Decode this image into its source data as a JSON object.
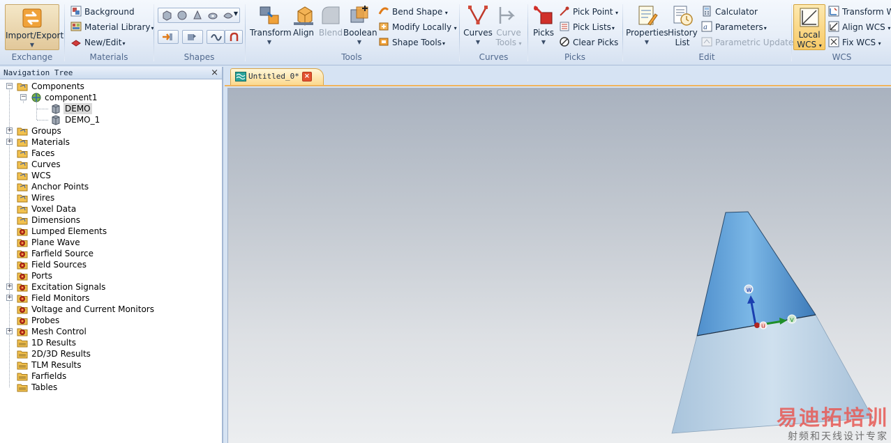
{
  "ribbon": {
    "exchange": {
      "title": "Exchange",
      "import_export": "Import/Export"
    },
    "materials": {
      "title": "Materials",
      "background": "Background",
      "material_library": "Material Library",
      "new_edit": "New/Edit"
    },
    "shapes": {
      "title": "Shapes"
    },
    "tools": {
      "title": "Tools",
      "transform": "Transform",
      "align": "Align",
      "blend": "Blend",
      "boolean": "Boolean",
      "bend_shape": "Bend Shape",
      "modify_locally": "Modify Locally",
      "shape_tools": "Shape Tools"
    },
    "curves": {
      "title": "Curves",
      "curves": "Curves",
      "curve_tools_line1": "Curve",
      "curve_tools_line2": "Tools"
    },
    "picks": {
      "title": "Picks",
      "picks": "Picks",
      "pick_point": "Pick Point",
      "pick_lists": "Pick Lists",
      "clear_picks": "Clear Picks"
    },
    "edit": {
      "title": "Edit",
      "properties": "Properties",
      "history_line1": "History",
      "history_line2": "List",
      "calculator": "Calculator",
      "parameters": "Parameters",
      "parametric_update": "Parametric Update"
    },
    "wcs": {
      "title": "WCS",
      "local_line1": "Local",
      "local_line2": "WCS",
      "transform_wcs": "Transform WCS",
      "align_wcs": "Align WCS",
      "fix_wcs": "Fix WCS"
    }
  },
  "nav": {
    "title": "Navigation Tree",
    "close": "×",
    "items": [
      {
        "label": "Components"
      },
      {
        "label": "component1"
      },
      {
        "label": "DEMO"
      },
      {
        "label": "DEMO_1"
      },
      {
        "label": "Groups"
      },
      {
        "label": "Materials"
      },
      {
        "label": "Faces"
      },
      {
        "label": "Curves"
      },
      {
        "label": "WCS"
      },
      {
        "label": "Anchor Points"
      },
      {
        "label": "Wires"
      },
      {
        "label": "Voxel Data"
      },
      {
        "label": "Dimensions"
      },
      {
        "label": "Lumped Elements"
      },
      {
        "label": "Plane Wave"
      },
      {
        "label": "Farfield Source"
      },
      {
        "label": "Field Sources"
      },
      {
        "label": "Ports"
      },
      {
        "label": "Excitation Signals"
      },
      {
        "label": "Field Monitors"
      },
      {
        "label": "Voltage and Current Monitors"
      },
      {
        "label": "Probes"
      },
      {
        "label": "Mesh Control"
      },
      {
        "label": "1D Results"
      },
      {
        "label": "2D/3D Results"
      },
      {
        "label": "TLM Results"
      },
      {
        "label": "Farfields"
      },
      {
        "label": "Tables"
      }
    ]
  },
  "document": {
    "tab_label": "Untitled_0*",
    "tab_close": "×"
  },
  "viewport": {
    "wcs_u": "u",
    "wcs_v": "v",
    "wcs_w": "w"
  },
  "watermark": {
    "main": "易迪拓培训",
    "sub": "射频和天线设计专家"
  },
  "colors": {
    "accent": "#f0b35a",
    "selection": "#fde9b0",
    "cone_top": "#5c9fd6",
    "cone_bottom": "#b8d1e6"
  }
}
